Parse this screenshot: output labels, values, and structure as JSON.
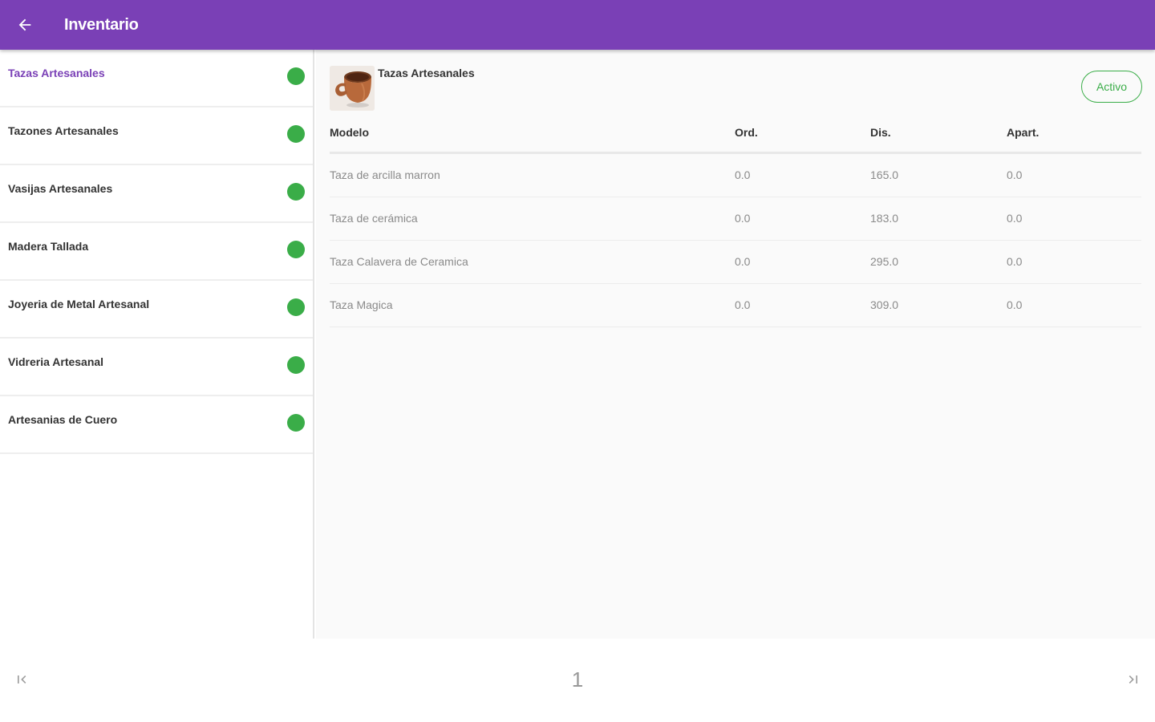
{
  "appbar": {
    "title": "Inventario",
    "back_icon": "arrow-left-icon"
  },
  "colors": {
    "brand": "#7a40b6",
    "active_green": "#3aad48"
  },
  "sidebar": {
    "items": [
      {
        "label": "Tazas Artesanales",
        "status": "active",
        "selected": true
      },
      {
        "label": "Tazones Artesanales",
        "status": "active",
        "selected": false
      },
      {
        "label": "Vasijas Artesanales",
        "status": "active",
        "selected": false
      },
      {
        "label": "Madera Tallada",
        "status": "active",
        "selected": false
      },
      {
        "label": "Joyeria de Metal Artesanal",
        "status": "active",
        "selected": false
      },
      {
        "label": "Vidreria Artesanal",
        "status": "active",
        "selected": false
      },
      {
        "label": "Artesanias de Cuero",
        "status": "active",
        "selected": false
      }
    ]
  },
  "detail": {
    "product_name": "Tazas Artesanales",
    "product_image_icon": "mug-icon",
    "status_label": "Activo",
    "table": {
      "headers": [
        "Modelo",
        "Ord.",
        "Dis.",
        "Apart."
      ],
      "rows": [
        [
          "Taza de arcilla marron",
          "0.0",
          "165.0",
          "0.0"
        ],
        [
          "Taza de cerámica",
          "0.0",
          "183.0",
          "0.0"
        ],
        [
          "Taza Calavera de Ceramica",
          "0.0",
          "295.0",
          "0.0"
        ],
        [
          "Taza Magica",
          "0.0",
          "309.0",
          "0.0"
        ]
      ]
    }
  },
  "pagination": {
    "current_page": "1",
    "first_icon": "first-page-icon",
    "last_icon": "last-page-icon"
  }
}
